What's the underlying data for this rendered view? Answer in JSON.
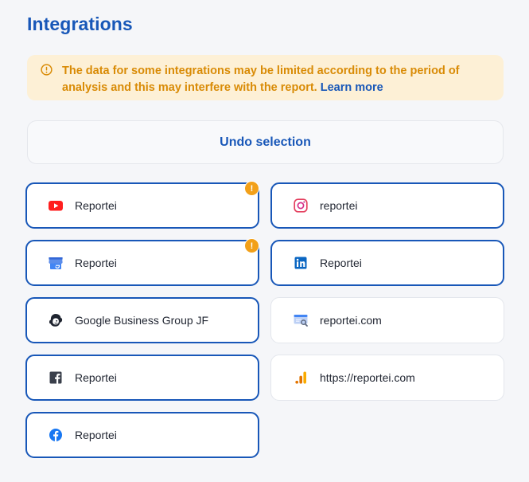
{
  "header": {
    "title": "Integrations"
  },
  "alert": {
    "text": "The data for some integrations may be limited according to the period of analysis and this may interfere with the report.",
    "link": "Learn more",
    "color": "#d98b06"
  },
  "undo": {
    "label": "Undo selection"
  },
  "accent": "#1857b8",
  "integrations": [
    {
      "label": "Reportei",
      "icon": "youtube-icon",
      "selected": true,
      "warning": true,
      "warning_glyph": "!"
    },
    {
      "label": "reportei",
      "icon": "instagram-icon",
      "selected": true,
      "warning": false
    },
    {
      "label": "Reportei",
      "icon": "google-business-profile-icon",
      "selected": true,
      "warning": true,
      "warning_glyph": "!"
    },
    {
      "label": "Reportei",
      "icon": "linkedin-icon",
      "selected": true,
      "warning": false
    },
    {
      "label": "Google Business Group JF",
      "icon": "mailchimp-icon",
      "selected": true,
      "warning": false
    },
    {
      "label": "reportei.com",
      "icon": "google-search-console-icon",
      "selected": false,
      "warning": false
    },
    {
      "label": "Reportei",
      "icon": "facebook-square-icon",
      "selected": true,
      "warning": false
    },
    {
      "label": "https://reportei.com",
      "icon": "google-analytics-icon",
      "selected": false,
      "warning": false
    },
    {
      "label": "Reportei",
      "icon": "facebook-circle-icon",
      "selected": true,
      "warning": false
    }
  ]
}
